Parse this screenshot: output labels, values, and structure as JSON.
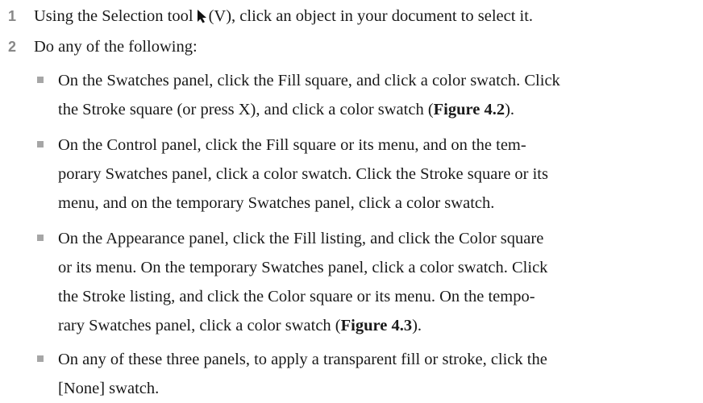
{
  "steps": [
    {
      "number": "1",
      "text_before": "Using the Selection tool",
      "icon": "selection-arrow-icon",
      "text_after": "(V), click an object in your document to select it."
    },
    {
      "number": "2",
      "text": "Do any of the following:"
    }
  ],
  "bullets": [
    {
      "line1": "On the Swatches panel, click the Fill square, and click a color swatch. Click",
      "line2_before": "the Stroke square (or press X), and click a color swatch (",
      "line2_figure": "Figure 4.2",
      "line2_after": ")."
    },
    {
      "line1": "On the Control panel, click the Fill square or its menu, and on the tem-",
      "line2": "porary Swatches panel, click a color swatch. Click the Stroke square or its",
      "line3": "menu, and on the temporary Swatches panel, click a color swatch."
    },
    {
      "line1": "On the Appearance panel, click the Fill listing, and click the Color square",
      "line2": "or its menu. On the temporary Swatches panel, click a color swatch. Click",
      "line3": "the Stroke listing, and click the Color square or its menu. On the tempo-",
      "line4_before": "rary Swatches panel, click a color swatch (",
      "line4_figure": "Figure 4.3",
      "line4_after": ")."
    },
    {
      "line1": "On any of these three panels, to apply a transparent fill or stroke, click the",
      "line2": "[None] swatch."
    }
  ],
  "colors": {
    "step_number": "#888888",
    "bullet_square": "#a6a6a6",
    "text": "#1a1a1a"
  }
}
